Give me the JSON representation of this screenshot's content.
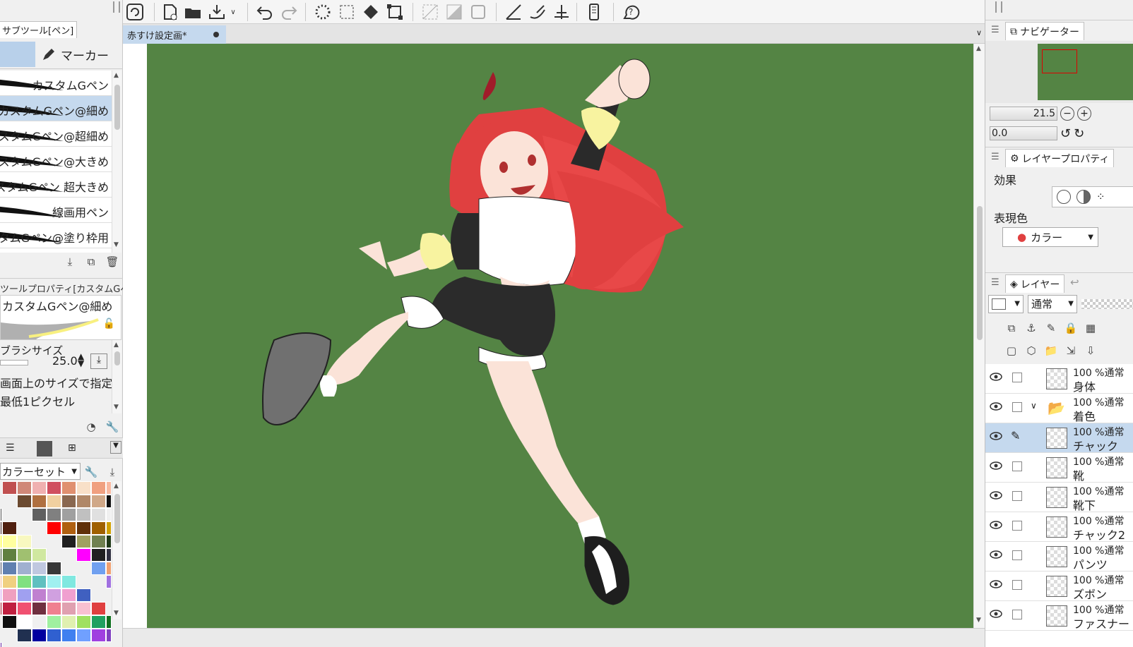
{
  "subtool": {
    "tab_label": "サブツール[ペン]",
    "category_label": "マーカー",
    "brushes": [
      {
        "name": "カスタムGペン"
      },
      {
        "name": "カスタムGペン@細め"
      },
      {
        "name": "カスタムGペン@超細め"
      },
      {
        "name": "カスタムGペン@大きめ"
      },
      {
        "name": "カスタムGペン 超大きめ"
      },
      {
        "name": "線画用ペン"
      },
      {
        "name": "カスタムGペン@塗り枠用"
      }
    ]
  },
  "tool_property": {
    "title": "ツールプロパティ[カスタムGペン@細め]",
    "brush_name": "カスタムGペン@細め",
    "size_label": "ブラシサイズ",
    "size_value": "25.0",
    "option1": "画面上のサイズで指定",
    "option2": "最低1ピクセル"
  },
  "color": {
    "set_label": "カラーセット",
    "swatches": [
      "#c05050",
      "#d08878",
      "#f0b0b0",
      "#d05060",
      "#e09070",
      "#f8e0c8",
      "#f0a080",
      "#f8b8a0",
      "#6b4a30",
      "#b07040",
      "#f0d0a0",
      "#8a6850",
      "#b08868",
      "#d0a888",
      "#101010",
      "#505050",
      "#606060",
      "#808080",
      "#a0a0a0",
      "#c0c0c0",
      "#e0e0e0",
      "#f0f0f0",
      "#381818",
      "#502010",
      "#ff0000",
      "#b06010",
      "#603008",
      "#a06000",
      "#d0a000",
      "#ffff00",
      "#ffffa0",
      "#f8f8c0",
      "#202020",
      "#a0a060",
      "#708050",
      "#203818",
      "#304820",
      "#608040",
      "#a0c070",
      "#d0e8a0",
      "#ff00ff",
      "#202020",
      "#303040",
      "#404860",
      "#6080b0",
      "#a0b0d0",
      "#c0c8e0",
      "#383838",
      "#70a0f0",
      "#f0a070",
      "#f8b888",
      "#f0d080",
      "#80e080",
      "#60c0c0",
      "#a0f0f0",
      "#80e8e0",
      "#a070e0",
      "#d0a0f0",
      "#f0a0c0",
      "#a0a0f0",
      "#c080d0",
      "#d0a0e0",
      "#f0a0d0",
      "#4060c0",
      "#a01020",
      "#c02040",
      "#f05070",
      "#703040",
      "#f08090",
      "#e0a0b0",
      "#f8c0d0",
      "#e04040",
      "#101010",
      "#ffffff",
      "#f0f0f0",
      "#a0f0a0",
      "#e0f0b0",
      "#a0e060",
      "#20a060",
      "#107020",
      "#203050",
      "#0000a0",
      "#3060d0",
      "#4080f0",
      "#70a0ff",
      "#a040e0",
      "#8040c0",
      "#6020a0"
    ]
  },
  "document": {
    "tab_title": "赤すけ設定画*"
  },
  "navigator": {
    "tab_label": "ナビゲーター",
    "zoom": "21.5",
    "rotation": "0.0"
  },
  "layer_property": {
    "tab_label": "レイヤープロパティ",
    "effect_label": "効果",
    "expression_label": "表現色",
    "expression_value": "カラー"
  },
  "layers": {
    "tab_label": "レイヤー",
    "blend_mode": "通常",
    "items": [
      {
        "pct": "100 %通常",
        "name": "身体"
      },
      {
        "pct": "100 %通常",
        "name": "着色"
      },
      {
        "pct": "100 %通常",
        "name": "チャック"
      },
      {
        "pct": "100 %通常",
        "name": "靴"
      },
      {
        "pct": "100 %通常",
        "name": "靴下"
      },
      {
        "pct": "100 %通常",
        "name": "チャック2"
      },
      {
        "pct": "100 %通常",
        "name": "パンツ"
      },
      {
        "pct": "100 %通常",
        "name": "ズボン"
      },
      {
        "pct": "100 %通常",
        "name": "ファスナー"
      }
    ]
  }
}
